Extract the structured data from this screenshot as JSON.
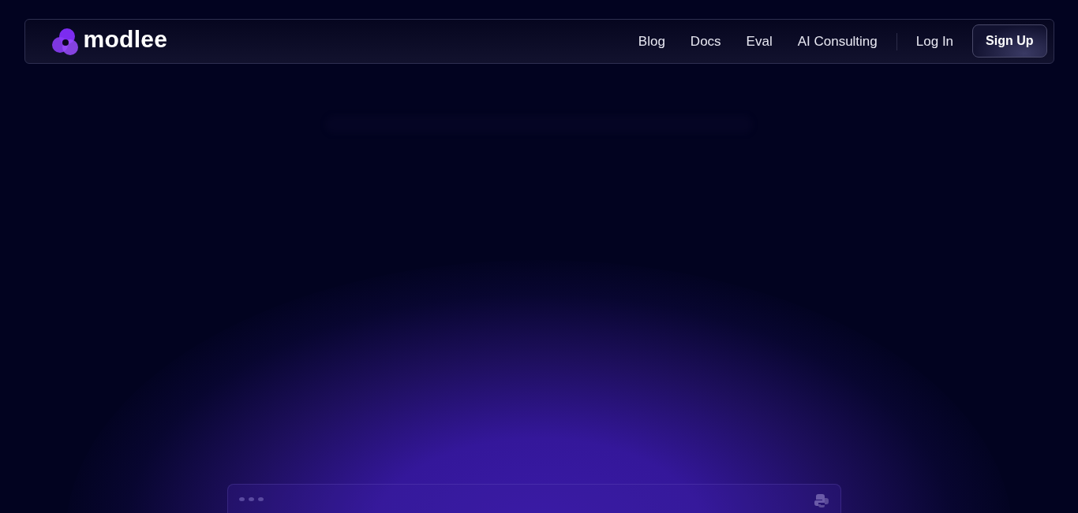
{
  "brand": {
    "name": "modlee"
  },
  "nav": {
    "links": [
      {
        "label": "Blog"
      },
      {
        "label": "Docs"
      },
      {
        "label": "Eval"
      },
      {
        "label": "AI Consulting"
      }
    ],
    "login": "Log In",
    "signup": "Sign Up"
  }
}
